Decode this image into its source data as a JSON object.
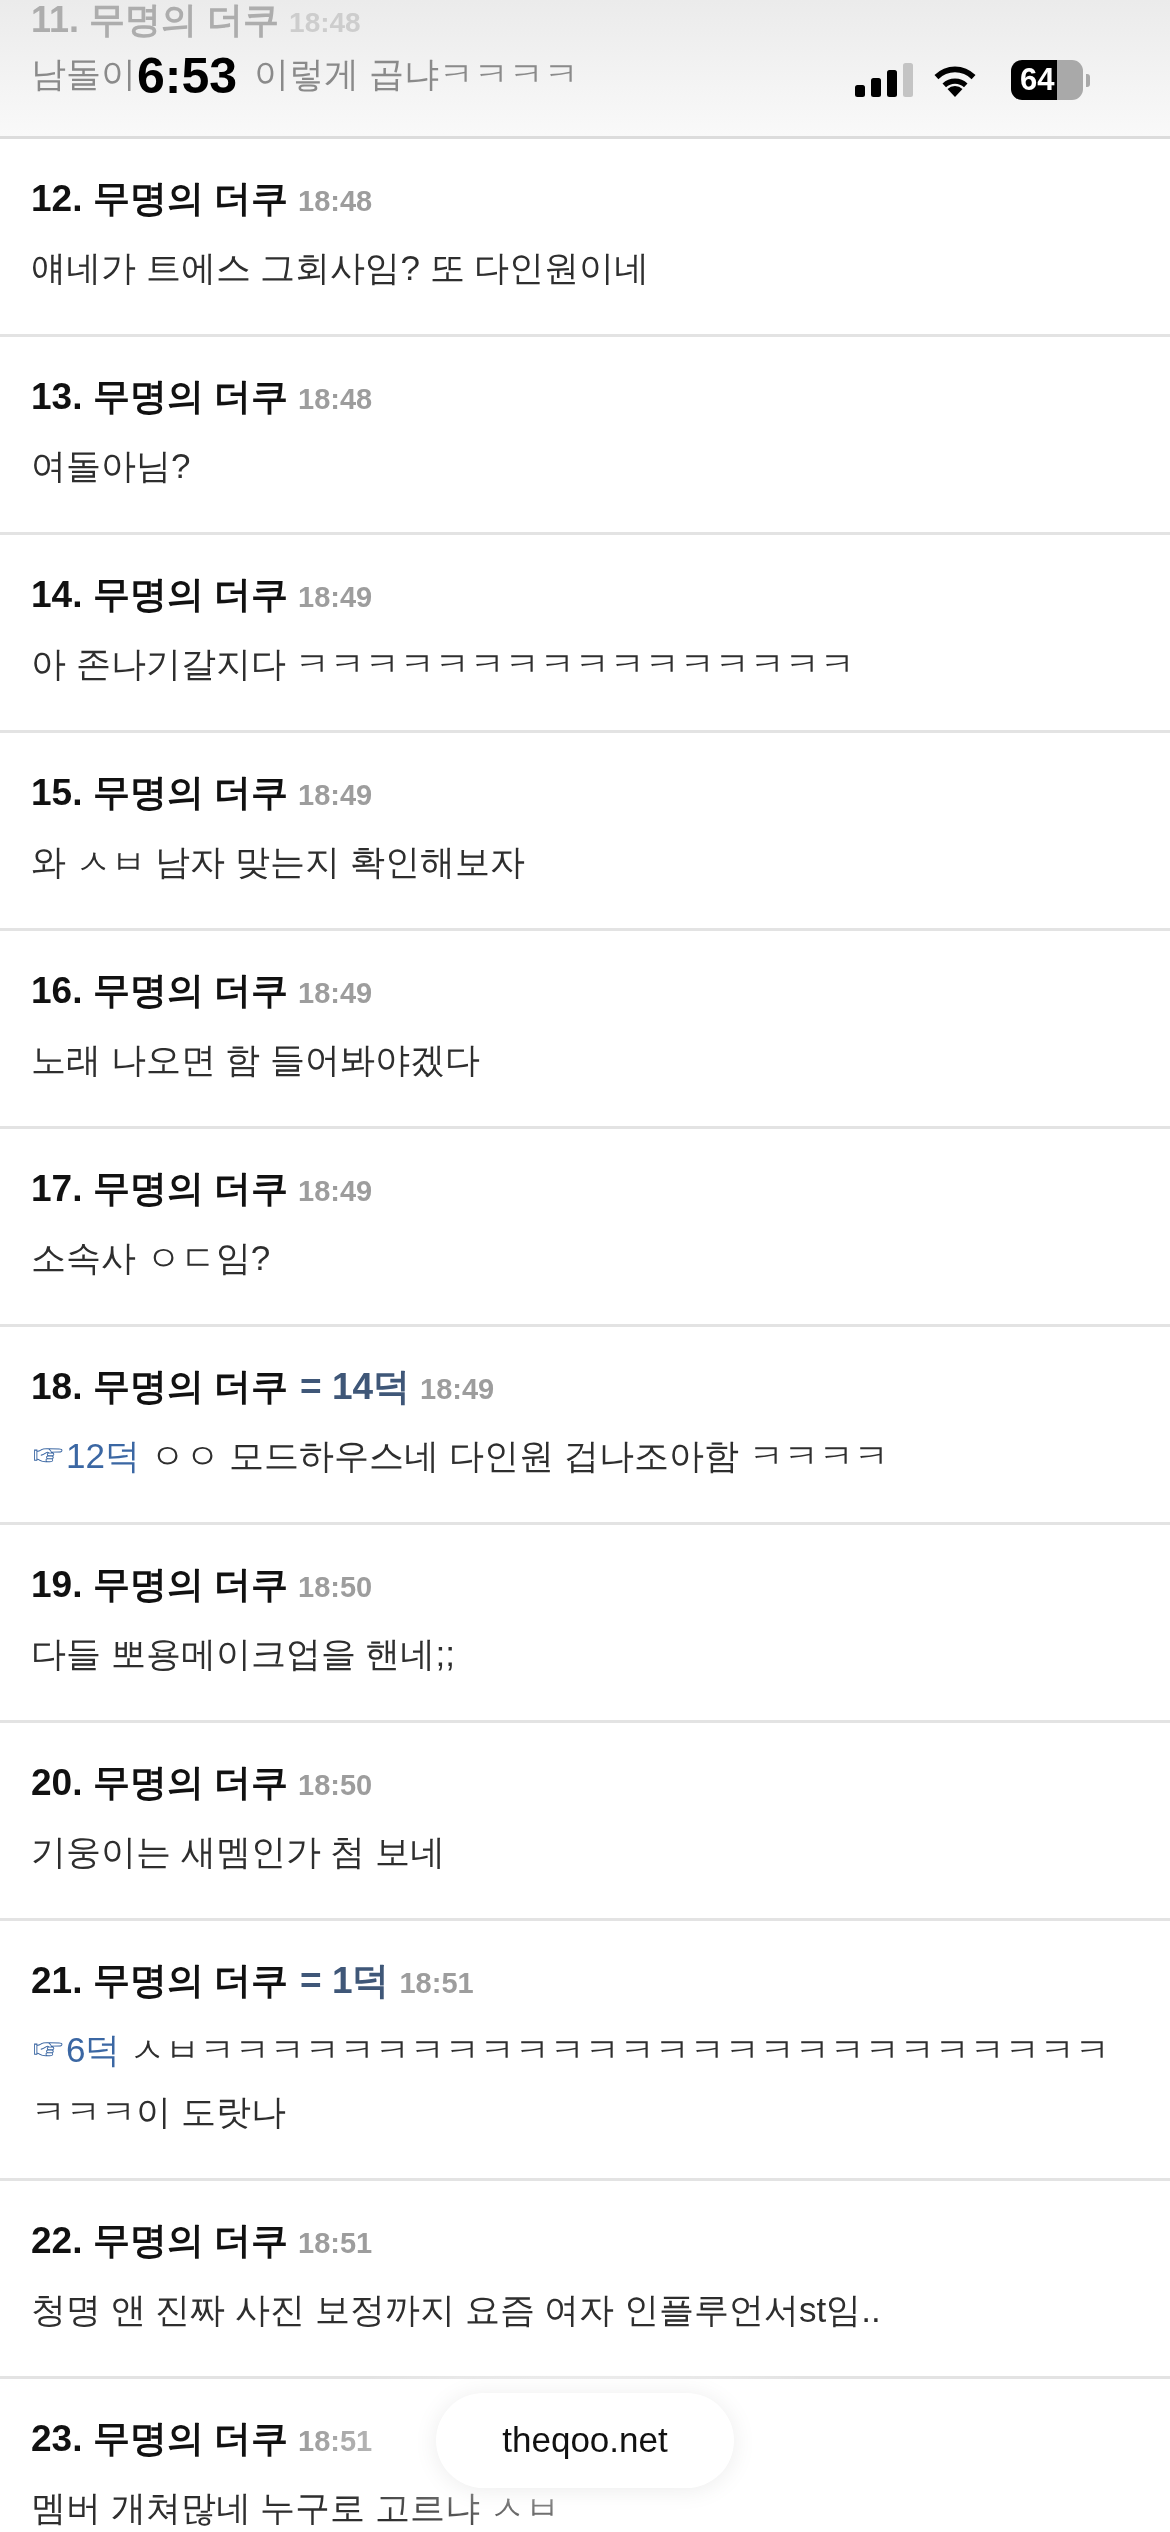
{
  "status_bar": {
    "time": "6:53",
    "battery": "64"
  },
  "covered_comment": {
    "title": "11. 무명의 더쿠",
    "time": "18:48",
    "text_parts": [
      "남돌이",
      "이렇게 곱냐ㅋㅋㅋㅋ"
    ]
  },
  "comments": [
    {
      "title": "12. 무명의 더쿠",
      "time": "18:48",
      "text": "얘네가 트에스 그회사임? 또 다인원이네"
    },
    {
      "title": "13. 무명의 더쿠",
      "time": "18:48",
      "text": "여돌아님?"
    },
    {
      "title": "14. 무명의 더쿠",
      "time": "18:49",
      "text": "아 존나기갈지다 ㅋㅋㅋㅋㅋㅋㅋㅋㅋㅋㅋㅋㅋㅋㅋㅋ"
    },
    {
      "title": "15. 무명의 더쿠",
      "time": "18:49",
      "text": "와 ㅅㅂ 남자 맞는지 확인해보자"
    },
    {
      "title": "16. 무명의 더쿠",
      "time": "18:49",
      "text": "노래 나오면 함 들어봐야겠다"
    },
    {
      "title": "17. 무명의 더쿠",
      "time": "18:49",
      "text": "소속사 ㅇㄷ임?"
    },
    {
      "title": "18. 무명의 더쿠",
      "reply_tag": "= 14덕",
      "time": "18:49",
      "quote": "☞12덕",
      "text": "ㅇㅇ 모드하우스네 다인원 겁나조아함 ㅋㅋㅋㅋ"
    },
    {
      "title": "19. 무명의 더쿠",
      "time": "18:50",
      "text": "다들 뽀용메이크업을 핸네;;"
    },
    {
      "title": "20. 무명의 더쿠",
      "time": "18:50",
      "text": "기웅이는 새멤인가 첨 보네"
    },
    {
      "title": "21. 무명의 더쿠",
      "reply_tag": "= 1덕",
      "time": "18:51",
      "quote": "☞6덕",
      "text": "ㅅㅂㅋㅋㅋㅋㅋㅋㅋㅋㅋㅋㅋㅋㅋㅋㅋㅋㅋㅋㅋㅋㅋㅋㅋㅋㅋㅋㅋㅋㅋ이 도랏나"
    },
    {
      "title": "22. 무명의 더쿠",
      "time": "18:51",
      "text": "청명 앤 진짜 사진 보정까지 요즘 여자 인플루언서st임.."
    },
    {
      "title": "23. 무명의 더쿠",
      "time": "18:51",
      "text": "멤버 개쳐많네 누구로 고르냐 ㅅㅂ"
    }
  ],
  "url_bar": {
    "label": "theqoo.net"
  }
}
